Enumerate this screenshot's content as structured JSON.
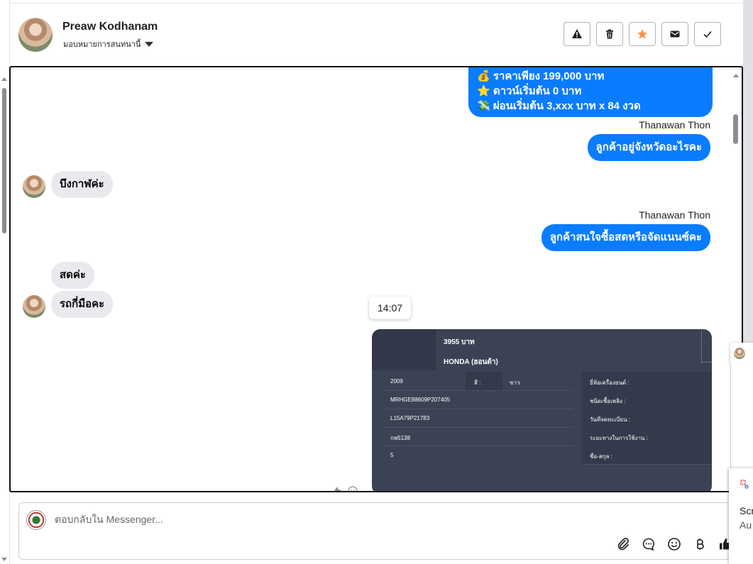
{
  "header": {
    "name": "Preaw Kodhanam",
    "assign_label": "มอบหมายการสนทนานี้",
    "actions": [
      "spam-icon",
      "trash-icon",
      "star-icon",
      "mail-icon",
      "check-icon"
    ]
  },
  "messages": {
    "promo_lines": [
      "💰 ราคาเพียง 199,000 บาท",
      "⭐ ดาวน์เริ่มต้น 0 บาท",
      "💸 ผ่อนเริ่มต้น 3,xxx บาท x 84 งวด"
    ],
    "sender_1": "Thanawan Thon",
    "out_1": "ลูกค้าอยู่จังหวัดอะไรคะ",
    "in_1": "บึงกาฬค่ะ",
    "sender_2": "Thanawan Thon",
    "out_2": "ลูกค้าสนใจซื้อสดหรือจัดแนนซ์คะ",
    "in_2": "สดค่ะ",
    "in_3": "รถกี่มือคะ",
    "time": "14:07"
  },
  "card": {
    "price": "3955 บาท",
    "brand": "HONDA (ฮอนด้า)",
    "year": "2009",
    "color_label": "สี :",
    "color_value": "ขาว",
    "vin": "MRHGE88609P207405",
    "engine": "L15A79P21783",
    "plate": "กพ5138",
    "seats": "5",
    "right_labels": [
      "ยี่ห้อเครื่องยนต์ :",
      "ชนิดเชื้อเพลิง :",
      "วันที่จดทะเบียน :",
      "ระยะทางในการใช้งาน :",
      "ชื่อ-สกุล :"
    ]
  },
  "composer": {
    "placeholder": "ตอบกลับใน Messenger...",
    "tools": [
      "attach-icon",
      "chat-bubble-icon",
      "emoji-icon",
      "baht-icon",
      "thumbs-up-icon"
    ]
  },
  "side": {
    "toast_line1": "Scr",
    "toast_line2": "Au"
  }
}
